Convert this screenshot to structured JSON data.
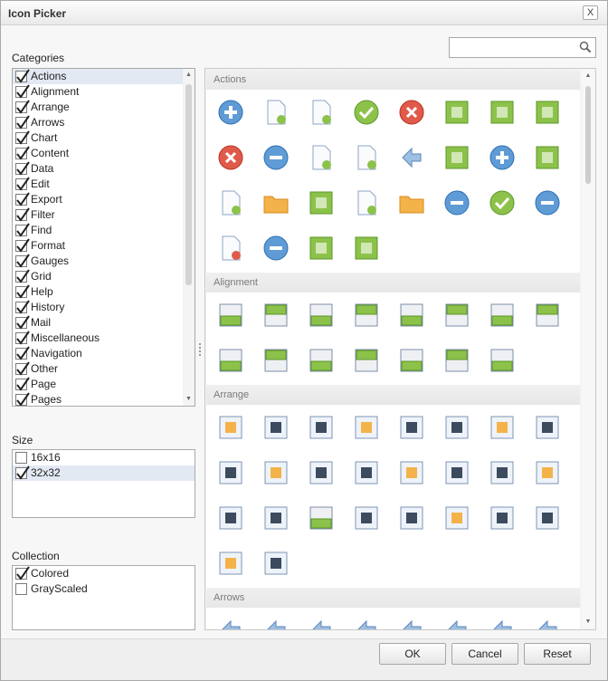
{
  "window": {
    "title": "Icon Picker",
    "close_label": "X"
  },
  "search": {
    "value": "",
    "placeholder": ""
  },
  "categories": {
    "label": "Categories",
    "items": [
      {
        "label": "Actions",
        "checked": true,
        "selected": true
      },
      {
        "label": "Alignment",
        "checked": true
      },
      {
        "label": "Arrange",
        "checked": true
      },
      {
        "label": "Arrows",
        "checked": true
      },
      {
        "label": "Chart",
        "checked": true
      },
      {
        "label": "Content",
        "checked": true
      },
      {
        "label": "Data",
        "checked": true
      },
      {
        "label": "Edit",
        "checked": true
      },
      {
        "label": "Export",
        "checked": true
      },
      {
        "label": "Filter",
        "checked": true
      },
      {
        "label": "Find",
        "checked": true
      },
      {
        "label": "Format",
        "checked": true
      },
      {
        "label": "Gauges",
        "checked": true
      },
      {
        "label": "Grid",
        "checked": true
      },
      {
        "label": "Help",
        "checked": true
      },
      {
        "label": "History",
        "checked": true
      },
      {
        "label": "Mail",
        "checked": true
      },
      {
        "label": "Miscellaneous",
        "checked": true
      },
      {
        "label": "Navigation",
        "checked": true
      },
      {
        "label": "Other",
        "checked": true
      },
      {
        "label": "Page",
        "checked": true
      },
      {
        "label": "Pages",
        "checked": true
      }
    ]
  },
  "size": {
    "label": "Size",
    "items": [
      {
        "label": "16x16",
        "checked": false
      },
      {
        "label": "32x32",
        "checked": true,
        "selected": true
      }
    ]
  },
  "collection": {
    "label": "Collection",
    "items": [
      {
        "label": "Colored",
        "checked": true
      },
      {
        "label": "GrayScaled",
        "checked": false
      }
    ]
  },
  "gallery": {
    "groups": [
      {
        "name": "Actions",
        "icons": [
          "add-icon",
          "new-document-add-icon",
          "new-document-add-blue-icon",
          "apply-icon",
          "cancel-red-icon",
          "eraser-icon",
          "clear-formatting-icon",
          "cut-icon",
          "delete-icon",
          "refresh-icon",
          "remove-document-icon",
          "delete-document-icon",
          "download-icon",
          "move-icon",
          "hide-icon",
          "edit-image-icon",
          "insert-icon",
          "open-folder-icon",
          "copy-icon",
          "new-document-icon",
          "folder-icon",
          "reset-icon",
          "redo-icon",
          "remove-icon",
          "remove-document-blue-icon",
          "show-icon",
          "split-horizontal-icon",
          "merge-horizontal-icon"
        ]
      },
      {
        "name": "Alignment",
        "icons": [
          "align-bottom-icon",
          "align-bottom-bars-icon",
          "align-middle-icon",
          "center-vertical-icon",
          "align-top-icon",
          "align-top-bars-icon",
          "align-vertical-center-icon",
          "center-horizontal-icon",
          "align-left-icon",
          "align-left-bars-icon",
          "align-right-icon",
          "align-right-bars-icon",
          "distribute-columns-icon",
          "distribute-rows-icon",
          "text-alignment-icon"
        ]
      },
      {
        "name": "Arrange",
        "icons": [
          "bring-forward-icon",
          "bring-to-front-icon",
          "bring-to-front-2-icon",
          "bring-to-front-circle-icon",
          "bring-to-front-red-icon",
          "bring-forward-2-icon",
          "send-backward-icon",
          "send-backward-2-icon",
          "send-to-back-icon",
          "send-to-back-circle-icon",
          "send-to-back-2-icon",
          "wrap-behind-icon",
          "wrap-in-front-icon",
          "wrap-square-icon",
          "wrap-tight-icon",
          "wrap-through-icon",
          "wrap-top-bottom-icon",
          "picture-left-icon",
          "picture-center-icon",
          "picture-right-icon",
          "picture-top-icon",
          "picture-middle-icon",
          "picture-bottom-icon",
          "picture-text-icon",
          "picture-inline-icon",
          "picture-float-icon"
        ]
      },
      {
        "name": "Arrows",
        "icons": [
          "double-first-icon",
          "double-last-icon",
          "double-next-icon",
          "double-prev-icon",
          "first-icon",
          "last-icon",
          "down-icon",
          "up-icon"
        ]
      }
    ]
  },
  "buttons": {
    "ok": "OK",
    "cancel": "Cancel",
    "reset": "Reset"
  }
}
